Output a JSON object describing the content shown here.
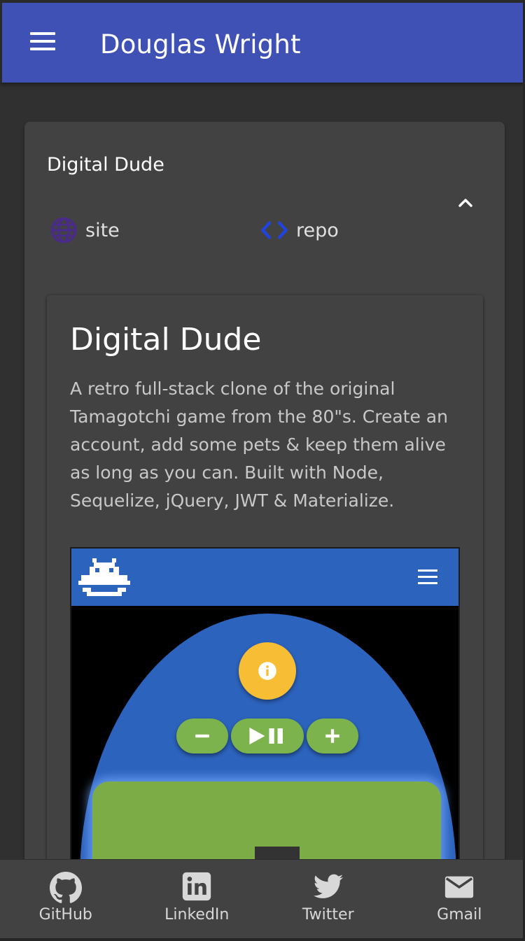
{
  "appbar": {
    "title": "Douglas Wright",
    "menu_icon": "hamburger-menu-icon",
    "color": "#3f51b5"
  },
  "project": {
    "panel_title": "Digital Dude",
    "collapse_icon": "chevron-up-icon",
    "links": [
      {
        "label": "site",
        "icon": "globe-icon",
        "icon_color": "#4a2a8a"
      },
      {
        "label": "repo",
        "icon": "code-icon",
        "icon_color": "#1e44e6"
      }
    ],
    "card": {
      "title": "Digital Dude",
      "description": "A retro full-stack clone of the original Tamagotchi game from the 80\"s. Create an account, add some pets & keep them alive as long as you can. Built with Node, Sequelize, jQuery, JWT & Materialize."
    },
    "screenshot": {
      "logo_icon": "alien-invader-icon",
      "menu_icon": "hamburger-menu-icon",
      "info_icon": "info-icon",
      "controls": [
        "minus-icon",
        "play-pause-icon",
        "plus-icon"
      ],
      "accent_blue": "#2c63bd",
      "button_yellow": "#f7bd35",
      "button_green": "#7db34c"
    }
  },
  "bottom_nav": {
    "items": [
      {
        "label": "GitHub",
        "icon": "github-icon"
      },
      {
        "label": "LinkedIn",
        "icon": "linkedin-icon"
      },
      {
        "label": "Twitter",
        "icon": "twitter-icon"
      },
      {
        "label": "Gmail",
        "icon": "mail-icon"
      }
    ]
  }
}
